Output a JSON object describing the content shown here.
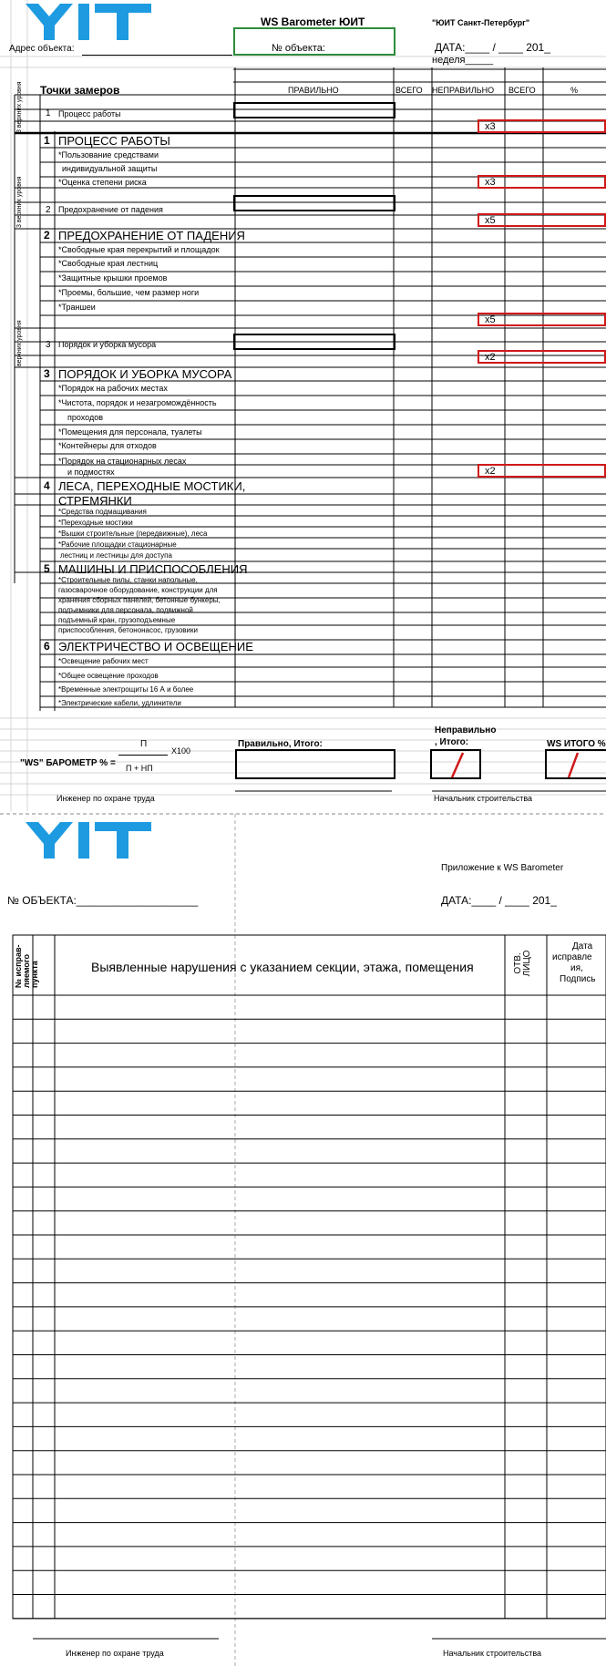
{
  "page1": {
    "header": {
      "title": "WS Barometer ЮИТ",
      "company": "\"ЮИТ Санкт-Петербург\"",
      "address_label": "Адрес объекта:",
      "object_no_label": "№ объекта:",
      "date_label": "ДАТА:____ / ____ 201_",
      "week_label": "неделя_____"
    },
    "columns": {
      "points": "Точки замеров",
      "correct": "ПРАВИЛЬНО",
      "total1": "ВСЕГО",
      "incorrect": "НЕПРАВИЛЬНО",
      "total2": "ВСЕГО",
      "percent": "%"
    },
    "side_label": "3 верхних уровня",
    "side_label_alt": "верхних уровня",
    "summary_rows": [
      {
        "num": "1",
        "label": "Процесс работы",
        "mult": "x3"
      },
      {
        "num": "2",
        "label": "Предохранение от падения",
        "mult": "x5"
      },
      {
        "num": "3",
        "label": "Порядок и уборка мусора",
        "mult": "x2"
      }
    ],
    "sections": [
      {
        "num": "1",
        "title": "ПРОЦЕСС РАБОТЫ",
        "items": [
          "*Пользование средствами",
          "индивидуальной защиты",
          "*Оценка степени риска"
        ],
        "mult": "x3"
      },
      {
        "num": "2",
        "title": "ПРЕДОХРАНЕНИЕ ОТ ПАДЕНИЯ",
        "items": [
          "*Свободные края перекрытий и площадок",
          "*Свободные края лестниц",
          "*Защитные крышки проемов",
          "*Проемы, большие, чем размер ноги",
          "*Траншеи"
        ],
        "mult": "x5"
      },
      {
        "num": "3",
        "title": "ПОРЯДОК И УБОРКА МУСОРА",
        "items": [
          "*Порядок на рабочих местах",
          "*Чистота, порядок и незагромождённость",
          "проходов",
          "*Помещения для персонала, туалеты",
          "*Контейнеры для отходов",
          "*Порядок на стационарных лесах",
          "и подмостях"
        ],
        "mult": "x2"
      },
      {
        "num": "4",
        "title": "ЛЕСА, ПЕРЕХОДНЫЕ МОСТИКИ,",
        "title2": "СТРЕМЯНКИ",
        "items": [
          "*Средства подмащивания",
          "*Переходные мостики",
          "*Вышки строительные (передвижные), леса",
          "*Рабочие площадки стационарные",
          "лестниц и лестницы для доступа"
        ]
      },
      {
        "num": "5",
        "title": "МАШИНЫ И ПРИСПОСОБЛЕНИЯ",
        "items": [
          "*Строительные пилы, станки напольные,",
          "газосварочное оборудование, конструкции для",
          "хранения сборных панелей, бетонные бункеры,",
          "подъемники для персонала, подвижной",
          "подъемный кран, грузоподъемные",
          "приспособления, бетононасос, грузовики"
        ]
      },
      {
        "num": "6",
        "title": "ЭЛЕКТРИЧЕСТВО И ОСВЕЩЕНИЕ",
        "items": [
          "*Освещение рабочих мест",
          "*Общее освещение проходов",
          "*Временные электрощиты 16 А и более",
          "*Электрические кабели, удлинители"
        ]
      }
    ],
    "formula": {
      "label": "\"WS\" БАРОМЕТР % =",
      "numerator": "П",
      "denominator": "П + НП",
      "multiplier": "X100"
    },
    "totals": {
      "correct_total": "Правильно, Итого:",
      "incorrect_total_1": "Неправильно",
      "incorrect_total_2": ", Итого:",
      "ws_total": "WS ИТОГО %"
    },
    "signatures": {
      "engineer": "Инженер по охране труда",
      "chief": "Начальник строительства"
    }
  },
  "page2": {
    "appendix": "Приложение к WS Barometer",
    "object_no": "№ ОБЪЕКТА:____________________",
    "date": "ДАТА:____ / ____ 201_",
    "col_num": "№ исправ-ляемого пункта",
    "col_desc": "Выявленные нарушения с указанием секции, этажа, помещения",
    "col_resp": "ОТВ. ЛИЦО",
    "col_date_1": "Дата",
    "col_date_2": "исправле",
    "col_date_3": "ия,",
    "col_date_4": "Подпись",
    "signatures": {
      "engineer": "Инженер по охране труда",
      "chief": "Начальник строительства"
    }
  },
  "colors": {
    "logo": "#1e9be0",
    "red": "#d01818",
    "green": "#2e8b3c"
  }
}
